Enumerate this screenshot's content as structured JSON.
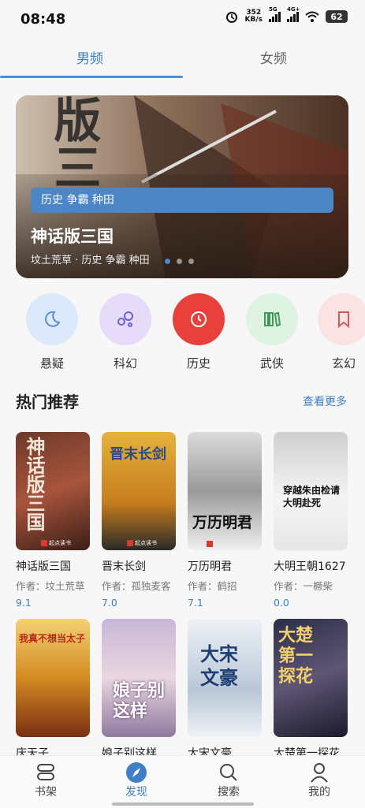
{
  "status": {
    "time": "08:48",
    "speed_value": "352",
    "speed_unit": "KB/s",
    "sig1": "5G",
    "sig2": "4G+",
    "battery": "62"
  },
  "tabs": [
    {
      "label": "男频"
    },
    {
      "label": "女频"
    }
  ],
  "banner": {
    "tags": "历史 争霸 种田",
    "title": "神话版三国",
    "subtitle": "坟土荒草 · 历史 争霸 种田",
    "cover_text": "版三"
  },
  "categories": [
    {
      "label": "悬疑",
      "icon": "moon-icon",
      "color": "#dbe9fa"
    },
    {
      "label": "科幻",
      "icon": "atom-icon",
      "color": "#e6dcfa"
    },
    {
      "label": "历史",
      "icon": "clock-icon",
      "color": "#e8413c"
    },
    {
      "label": "武侠",
      "icon": "books-icon",
      "color": "#dff3e3"
    },
    {
      "label": "玄幻",
      "icon": "bookmark-icon",
      "color": "#fbe3e3"
    }
  ],
  "section": {
    "title": "热门推荐",
    "more": "查看更多"
  },
  "books_row1": [
    {
      "title": "神话版三国",
      "author": "作者：坟土荒草",
      "score": "9.1",
      "cover_text": "神话版三国"
    },
    {
      "title": "晋末长剑",
      "author": "作者：孤独麦客",
      "score": "7.0",
      "cover_text": "晋末长剑"
    },
    {
      "title": "万历明君",
      "author": "作者：鹤招",
      "score": "7.1",
      "cover_text": "万历明君"
    },
    {
      "title": "大明王朝1627",
      "author": "作者：一橛柴",
      "score": "0.0",
      "cover_text": "穿越朱由检请大明赴死"
    }
  ],
  "books_row2": [
    {
      "title": "庆天子",
      "cover_text": "我真不想当太子"
    },
    {
      "title": "娘子别这样",
      "cover_text": "娘子别这样"
    },
    {
      "title": "大宋文豪",
      "cover_text": "大宋文豪"
    },
    {
      "title": "大楚第一探花",
      "cover_text": "大楚第一探花"
    }
  ],
  "cover_publisher": "起点读书",
  "nav": [
    {
      "label": "书架",
      "icon": "bookshelf-icon"
    },
    {
      "label": "发现",
      "icon": "compass-icon"
    },
    {
      "label": "搜索",
      "icon": "search-icon"
    },
    {
      "label": "我的",
      "icon": "user-icon"
    }
  ]
}
